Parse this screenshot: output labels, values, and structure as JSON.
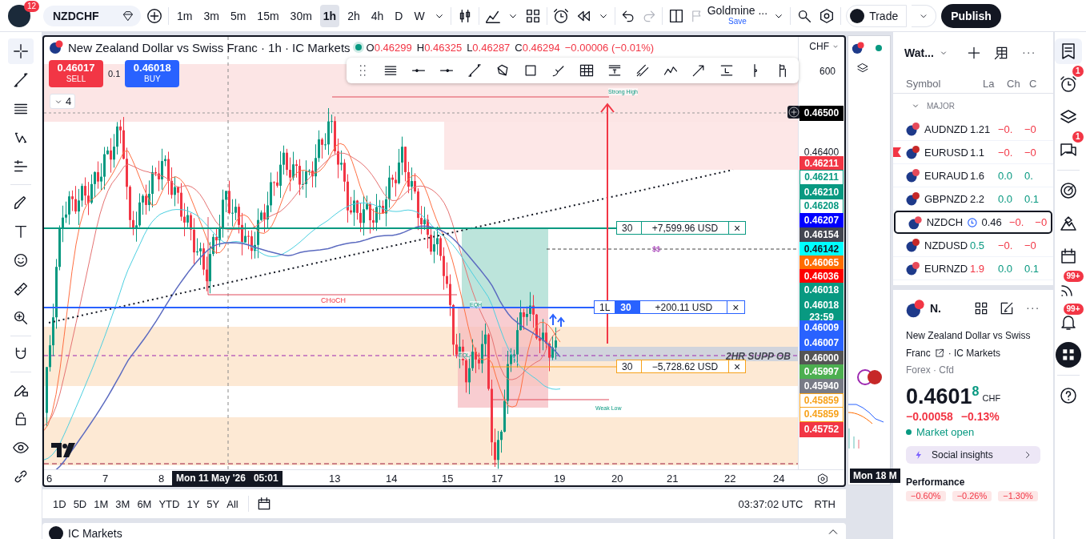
{
  "top_bar": {
    "notification_badge": "12",
    "symbol": "NZDCHF",
    "intervals": [
      {
        "label": "1m",
        "selected": false
      },
      {
        "label": "3m",
        "selected": false
      },
      {
        "label": "5m",
        "selected": false
      },
      {
        "label": "15m",
        "selected": false
      },
      {
        "label": "30m",
        "selected": false
      },
      {
        "label": "1h",
        "selected": true
      },
      {
        "label": "2h",
        "selected": false
      },
      {
        "label": "4h",
        "selected": false
      },
      {
        "label": "D",
        "selected": false
      },
      {
        "label": "W",
        "selected": false
      }
    ],
    "layout_name": "Goldmine ...",
    "save_label": "Save",
    "trade_label": "Trade",
    "publish_label": "Publish"
  },
  "chart": {
    "title": "New Zealand Dollar vs Swiss Franc · 1h · IC Markets",
    "ohlc": [
      {
        "key": "O",
        "value": "0.46299"
      },
      {
        "key": "H",
        "value": "0.46325"
      },
      {
        "key": "L",
        "value": "0.46287"
      },
      {
        "key": "C",
        "value": "0.46294"
      }
    ],
    "change": "−0.00006 (−0.01%)",
    "currency": "CHF",
    "sell": {
      "price": "0.46017",
      "label": "SELL"
    },
    "spread": "0.1",
    "buy": {
      "price": "0.46018",
      "label": "BUY"
    },
    "indicator_count": "4",
    "axis_partial_label": "600",
    "annotations": [
      {
        "kind": "small",
        "text": "Strong High"
      },
      {
        "kind": "red",
        "text": "CHoCH"
      },
      {
        "kind": "small",
        "text": "EQH"
      },
      {
        "kind": "small",
        "text": "EQL"
      },
      {
        "kind": "small",
        "text": "Weak Low"
      },
      {
        "kind": "purple",
        "text": "$$"
      },
      {
        "kind": "zone",
        "text": "2HR SUPP OB"
      }
    ],
    "positions": [
      {
        "kind": "take_profit",
        "quantity": "30",
        "pnl": "+7,599.96 USD",
        "close": "×"
      },
      {
        "kind": "position",
        "side": "1L",
        "quantity": "30",
        "pnl": "+200.11 USD",
        "close": "×"
      },
      {
        "kind": "stop_loss",
        "quantity": "30",
        "pnl": "−5,728.62 USD",
        "close": "×"
      }
    ],
    "price_labels": [
      {
        "text": "0.46500",
        "kind": "filled",
        "color": "#000000"
      },
      {
        "text": "0.46400",
        "kind": "plain",
        "color": "#131722"
      },
      {
        "text": "0.46211",
        "kind": "filled",
        "color": "#f23645"
      },
      {
        "text": "0.46211",
        "kind": "outline",
        "color": "#089981"
      },
      {
        "text": "0.46210",
        "kind": "filled",
        "color": "#089981"
      },
      {
        "text": "0.46208",
        "kind": "outline",
        "color": "#089981"
      },
      {
        "text": "0.46207",
        "kind": "filled",
        "color": "#0000ff"
      },
      {
        "text": "0.46154",
        "kind": "filled",
        "color": "#434651"
      },
      {
        "text": "0.46142",
        "kind": "filled",
        "color": "#00ffff"
      },
      {
        "text": "0.46065",
        "kind": "filled",
        "color": "#ff6d00"
      },
      {
        "text": "0.46036",
        "kind": "filled",
        "color": "#ff0000"
      },
      {
        "text": "0.46018",
        "kind": "filled",
        "color": "#089981"
      },
      {
        "text": "0.46018",
        "kind": "filled",
        "color": "#089981",
        "countdown": "23:59"
      },
      {
        "text": "0.46009",
        "kind": "filled",
        "color": "#2962ff"
      },
      {
        "text": "0.46007",
        "kind": "filled",
        "color": "#2962ff"
      },
      {
        "text": "0.46000",
        "kind": "filled",
        "color": "#555555"
      },
      {
        "text": "0.45997",
        "kind": "filled",
        "color": "#4caf50"
      },
      {
        "text": "0.45940",
        "kind": "filled",
        "color": "#787b86"
      },
      {
        "text": "0.45859",
        "kind": "outline",
        "color": "#f7a21b"
      },
      {
        "text": "0.45859",
        "kind": "outline",
        "color": "#f7a21b"
      },
      {
        "text": "0.45752",
        "kind": "filled",
        "color": "#f23645"
      }
    ],
    "time_labels": [
      {
        "text": "6",
        "kind": "tick"
      },
      {
        "text": "7",
        "kind": "tick"
      },
      {
        "text": "8",
        "kind": "tick"
      },
      {
        "text": "Mon 11 May '26   05:01",
        "kind": "crosshair"
      },
      {
        "text": "13",
        "kind": "tick"
      },
      {
        "text": "14",
        "kind": "tick"
      },
      {
        "text": "15",
        "kind": "tick"
      },
      {
        "text": "17",
        "kind": "tick"
      },
      {
        "text": "19",
        "kind": "tick"
      },
      {
        "text": "20",
        "kind": "tick"
      },
      {
        "text": "21",
        "kind": "tick"
      },
      {
        "text": "22",
        "kind": "tick"
      },
      {
        "text": "24",
        "kind": "tick"
      }
    ]
  },
  "range_bar": {
    "ranges": [
      "1D",
      "5D",
      "1M",
      "3M",
      "6M",
      "YTD",
      "1Y",
      "5Y",
      "All"
    ],
    "clock": "03:37:02 UTC",
    "session": "RTH"
  },
  "bottom_panel": {
    "title": "IC Markets"
  },
  "side_chart": {
    "time_label": "Mon 18 M"
  },
  "watchlist": {
    "title": "Wat...",
    "columns": [
      "Symbol",
      "La",
      "Ch",
      "C"
    ],
    "group": "MAJOR",
    "rows": [
      {
        "symbol": "AUDNZD",
        "last": "1.21",
        "change": "−0.",
        "change_pct": "−0",
        "last_up": false,
        "last_down": false,
        "change_up": false,
        "flagged": false,
        "selected": false
      },
      {
        "symbol": "EURUSD",
        "last": "1.1",
        "change": "−0.",
        "change_pct": "−0",
        "last_up": false,
        "last_down": false,
        "change_up": false,
        "flagged": true,
        "selected": false
      },
      {
        "symbol": "EURAUD",
        "last": "1.6",
        "change": "0.0",
        "change_pct": "0.",
        "last_up": false,
        "last_down": false,
        "change_up": true,
        "flagged": false,
        "selected": false
      },
      {
        "symbol": "GBPNZD",
        "last": "2.2",
        "change": "0.0",
        "change_pct": "0.1",
        "last_up": false,
        "last_down": false,
        "change_up": true,
        "flagged": false,
        "selected": false
      },
      {
        "symbol": "NZDCH",
        "last": "0.46",
        "change": "−0.",
        "change_pct": "−0",
        "last_up": false,
        "last_down": false,
        "change_up": false,
        "flagged": false,
        "selected": true
      },
      {
        "symbol": "NZDUSD",
        "last": "0.5",
        "change": "−0.",
        "change_pct": "−0",
        "last_up": true,
        "last_down": false,
        "change_up": false,
        "flagged": false,
        "selected": false
      },
      {
        "symbol": "EURNZD",
        "last": "1.9",
        "change": "0.0",
        "change_pct": "0.1",
        "last_up": false,
        "last_down": true,
        "change_up": true,
        "flagged": false,
        "selected": false
      }
    ]
  },
  "details": {
    "short_name": "N.",
    "description": "New Zealand Dollar vs Swiss",
    "description_2": "Franc",
    "exchange": "· IC Markets",
    "category": "Forex · Cfd",
    "price_main": "0.4601",
    "price_last_digit": "8",
    "currency": "CHF",
    "change": "−0.00058",
    "change_pct": "−0.13%",
    "market_status": "Market open",
    "social_label": "Social insights",
    "performance_title": "Performance",
    "performance": [
      "−0.60%",
      "−0.26%",
      "−1.30%"
    ]
  },
  "right_rail": [
    {
      "selected": true
    },
    {
      "selected": false,
      "badge": "1"
    },
    {
      "selected": false
    },
    {
      "selected": false,
      "badge": "1"
    },
    {
      "selected": false
    },
    {
      "selected": false
    },
    {
      "selected": false
    },
    {
      "selected": false,
      "badge": "99+"
    },
    {
      "selected": false,
      "badge": "99+"
    },
    {
      "selected": false
    },
    {
      "selected": false
    }
  ]
}
